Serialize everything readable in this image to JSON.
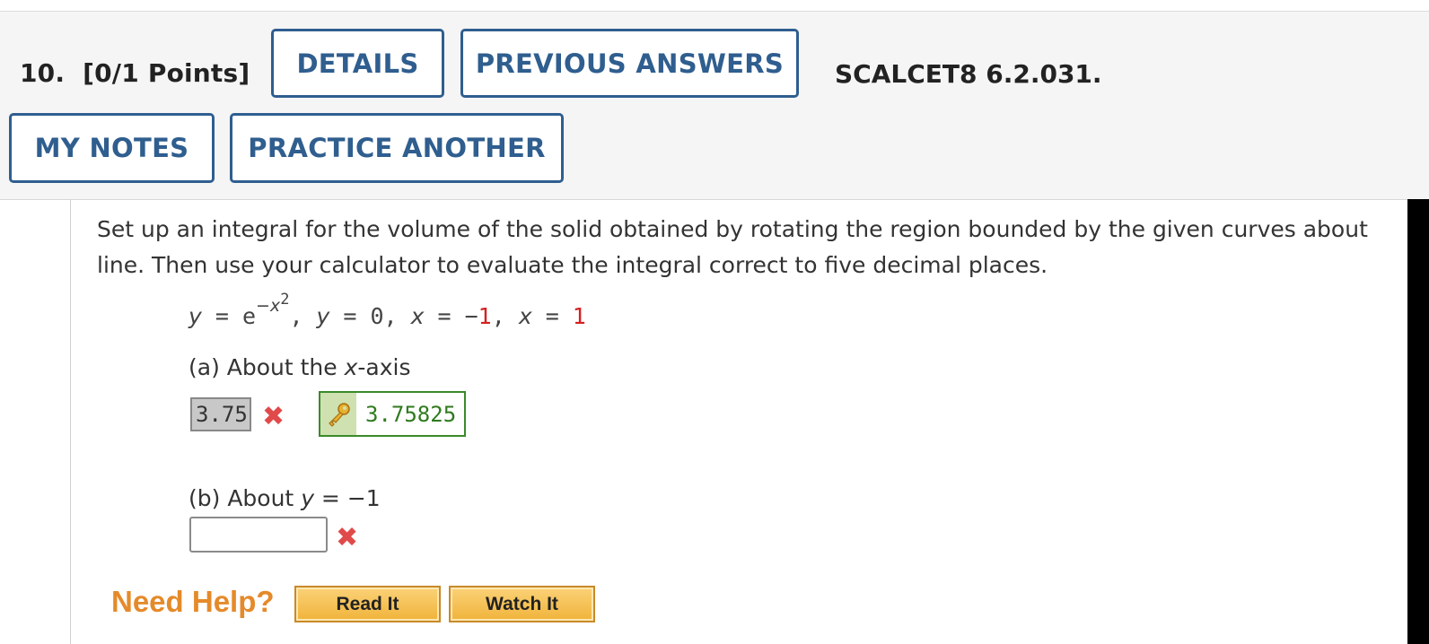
{
  "header": {
    "question_number": "10.",
    "points": "[0/1 Points]",
    "details_label": "DETAILS",
    "previous_answers_label": "PREVIOUS ANSWERS",
    "problem_code": "SCALCET8 6.2.031.",
    "my_notes_label": "MY NOTES",
    "practice_another_label": "PRACTICE ANOTHER"
  },
  "question": {
    "prompt_line1": "Set up an integral for the volume of the solid obtained by rotating the region bounded by the given curves about",
    "prompt_line2": "line. Then use your calculator to evaluate the integral correct to five decimal places.",
    "eq_y": "y",
    "eq_eq1": " = e",
    "eq_exp": "−x",
    "eq_exp_pow": "2",
    "eq_rest1": ", ",
    "eq_y2": "y",
    "eq_rest2": " = 0,  ",
    "eq_x1": "x",
    "eq_rest3": " = −",
    "eq_val1": "1",
    "eq_rest4": ",  ",
    "eq_x2": "x",
    "eq_rest5": " = ",
    "eq_val2": "1"
  },
  "part_a": {
    "label_prefix": "(a) About the ",
    "label_var": "x",
    "label_suffix": "-axis",
    "submitted_answer": "3.75",
    "correct_answer": "3.75825"
  },
  "part_b": {
    "label_prefix": "(b) About ",
    "label_var": "y",
    "label_suffix": " = −1",
    "submitted_answer": ""
  },
  "help": {
    "need_help_label": "Need Help?",
    "read_it_label": "Read It",
    "watch_it_label": "Watch It"
  },
  "icons": {
    "incorrect": "x-mark-icon",
    "key": "key-icon"
  },
  "colors": {
    "button_border": "#2f5e8f",
    "incorrect": "#e04a4a",
    "correct": "#2f7a1e",
    "help_orange": "#e58a2a"
  }
}
